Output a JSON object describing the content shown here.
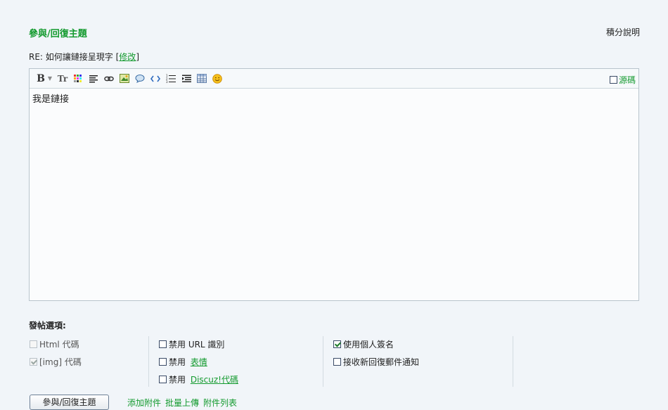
{
  "header": {
    "title": "參與/回復主題",
    "credit_link": "積分說明"
  },
  "subject": {
    "prefix": "RE: 如何讓鏈接呈現字",
    "edit_open": "[",
    "edit_label": "修改",
    "edit_close": "]"
  },
  "editor": {
    "source_label": "源碼",
    "content": "我是鏈接",
    "toolbar": [
      {
        "name": "bold",
        "glyph": "B"
      },
      {
        "name": "font-size",
        "glyph": "Tr"
      },
      {
        "name": "color",
        "glyph": "▦"
      },
      {
        "name": "align",
        "glyph": "≡"
      },
      {
        "name": "link",
        "glyph": "∞"
      },
      {
        "name": "image",
        "glyph": "▣"
      },
      {
        "name": "quote",
        "glyph": "◌"
      },
      {
        "name": "code",
        "glyph": "‹›"
      },
      {
        "name": "ordered-list",
        "glyph": "⋮"
      },
      {
        "name": "indent",
        "glyph": "⇥"
      },
      {
        "name": "table",
        "glyph": "▤"
      },
      {
        "name": "smiley",
        "glyph": "☺"
      }
    ]
  },
  "options": {
    "title": "發帖選項:",
    "html_code": "Html 代碼",
    "img_code": "[img] 代碼",
    "disable_url": "禁用 URL 識別",
    "disable_smilies_prefix": "禁用 ",
    "disable_smilies_link": "表情",
    "disable_discuz_prefix": "禁用 ",
    "disable_discuz_link": "Discuz!代碼",
    "use_signature": "使用個人簽名",
    "email_notify": "接收新回復郵件通知"
  },
  "actions": {
    "submit_label": "參與/回復主題",
    "add_attachment": "添加附件",
    "batch_upload": "批量上傳",
    "attachment_list": "附件列表"
  },
  "colors": {
    "accent": "#139a2e",
    "background": "#f1f5f9"
  }
}
